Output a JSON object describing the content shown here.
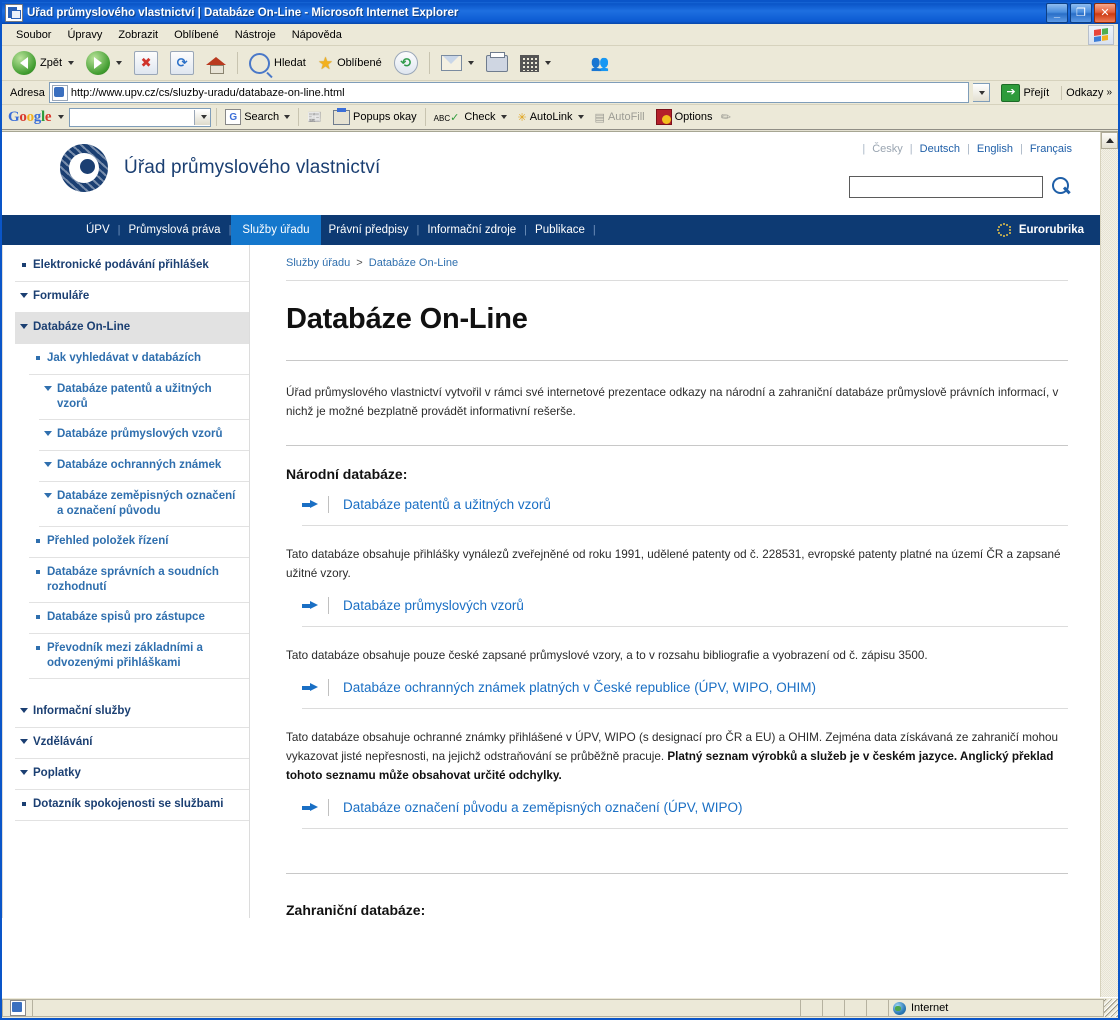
{
  "window": {
    "title": "Úřad průmyslového vlastnictví | Databáze On-Line - Microsoft Internet Explorer",
    "minimize_label": "_",
    "maximize_label": "❐",
    "close_label": "✕"
  },
  "menubar": {
    "items": [
      {
        "label": "Soubor"
      },
      {
        "label": "Úpravy"
      },
      {
        "label": "Zobrazit"
      },
      {
        "label": "Oblíbené"
      },
      {
        "label": "Nástroje"
      },
      {
        "label": "Nápověda"
      }
    ]
  },
  "toolbar": {
    "back_label": "Zpět",
    "search_label": "Hledat",
    "favorites_label": "Oblíbené"
  },
  "address": {
    "label": "Adresa",
    "url": "http://www.upv.cz/cs/sluzby-uradu/databaze-on-line.html",
    "go_label": "Přejít",
    "go_icon": "arrow-right-icon",
    "links_label": "Odkazy",
    "links_chevron": "»"
  },
  "google_toolbar": {
    "logo": [
      "G",
      "o",
      "o",
      "g",
      "l",
      "e"
    ],
    "search_value": "",
    "search_label": "Search",
    "popups_label": "Popups okay",
    "check_label": "Check",
    "autolink_label": "AutoLink",
    "autofill_label": "AutoFill",
    "options_label": "Options"
  },
  "site": {
    "brand_name": "Úřad průmyslového vlastnictví",
    "languages": [
      {
        "label": "Česky",
        "current": true
      },
      {
        "label": "Deutsch",
        "current": false
      },
      {
        "label": "English",
        "current": false
      },
      {
        "label": "Français",
        "current": false
      }
    ],
    "search_value": "",
    "nav": [
      {
        "label": "ÚPV",
        "active": false
      },
      {
        "label": "Průmyslová práva",
        "active": false
      },
      {
        "label": "Služby úřadu",
        "active": true
      },
      {
        "label": "Právní předpisy",
        "active": false
      },
      {
        "label": "Informační zdroje",
        "active": false
      },
      {
        "label": "Publikace",
        "active": false
      }
    ],
    "eurorubrika_label": "Eurorubrika"
  },
  "sidebar": {
    "items": [
      {
        "label": "Elektronické podávání přihlášek",
        "level": 1,
        "marker": "square",
        "selected": false
      },
      {
        "label": "Formuláře",
        "level": 1,
        "marker": "triangle",
        "selected": false
      },
      {
        "label": "Databáze On-Line",
        "level": 1,
        "marker": "triangle",
        "selected": true
      },
      {
        "label": "Jak vyhledávat v databázích",
        "level": 2,
        "marker": "square",
        "selected": false
      },
      {
        "label": "Databáze patentů a užitných vzorů",
        "level": 3,
        "marker": "triangle",
        "selected": false
      },
      {
        "label": "Databáze průmyslových vzorů",
        "level": 3,
        "marker": "triangle",
        "selected": false
      },
      {
        "label": "Databáze ochranných známek",
        "level": 3,
        "marker": "triangle",
        "selected": false
      },
      {
        "label": "Databáze zeměpisných označení a označení původu",
        "level": 3,
        "marker": "triangle",
        "selected": false
      },
      {
        "label": "Přehled položek řízení",
        "level": 2,
        "marker": "square",
        "selected": false
      },
      {
        "label": "Databáze správních a soudních rozhodnutí",
        "level": 2,
        "marker": "square",
        "selected": false
      },
      {
        "label": "Databáze spisů pro zástupce",
        "level": 2,
        "marker": "square",
        "selected": false
      },
      {
        "label": "Převodník mezi základními a odvozenými přihláškami",
        "level": 2,
        "marker": "square",
        "selected": false
      },
      {
        "label": "Informační služby",
        "level": 1,
        "marker": "triangle",
        "selected": false,
        "gap_before": true
      },
      {
        "label": "Vzdělávání",
        "level": 1,
        "marker": "triangle",
        "selected": false
      },
      {
        "label": "Poplatky",
        "level": 1,
        "marker": "triangle",
        "selected": false
      },
      {
        "label": "Dotazník spokojenosti se službami",
        "level": 1,
        "marker": "square",
        "selected": false
      }
    ]
  },
  "content": {
    "breadcrumb": {
      "parent": "Služby úřadu",
      "separator": ">",
      "current": "Databáze On-Line"
    },
    "title": "Databáze On-Line",
    "intro": "Úřad průmyslového vlastnictví vytvořil v rámci své internetové prezentace odkazy na národní a zahraniční databáze průmyslově právních informací, v nichž je možné bezplatně provádět informativní rešerše.",
    "section_national": "Národní databáze:",
    "blocks": [
      {
        "link": "Databáze patentů a užitných vzorů",
        "desc": "Tato databáze obsahuje přihlášky vynálezů zveřejněné od roku 1991, udělené patenty od č. 228531, evropské patenty platné na území ČR a zapsané užitné vzory.",
        "desc_bold": ""
      },
      {
        "link": "Databáze průmyslových vzorů",
        "desc": "Tato databáze obsahuje pouze české zapsané průmyslové vzory, a to v rozsahu bibliografie a vyobrazení od č. zápisu 3500.",
        "desc_bold": ""
      },
      {
        "link": "Databáze ochranných známek platných v České republice (ÚPV, WIPO, OHIM)",
        "desc": "Tato databáze obsahuje ochranné známky přihlášené v ÚPV, WIPO (s designací pro ČR a EU) a OHIM. Zejména data získávaná ze zahraničí mohou vykazovat jisté nepřesnosti, na jejichž odstraňování se průběžně pracuje. ",
        "desc_bold": "Platný seznam výrobků a služeb je v českém jazyce. Anglický překlad tohoto seznamu může obsahovat určité odchylky."
      },
      {
        "link": "Databáze označení původu a zeměpisných označení (ÚPV, WIPO)",
        "desc": "",
        "desc_bold": ""
      }
    ],
    "section_foreign": "Zahraniční databáze:"
  },
  "statusbar": {
    "zone": "Internet"
  }
}
